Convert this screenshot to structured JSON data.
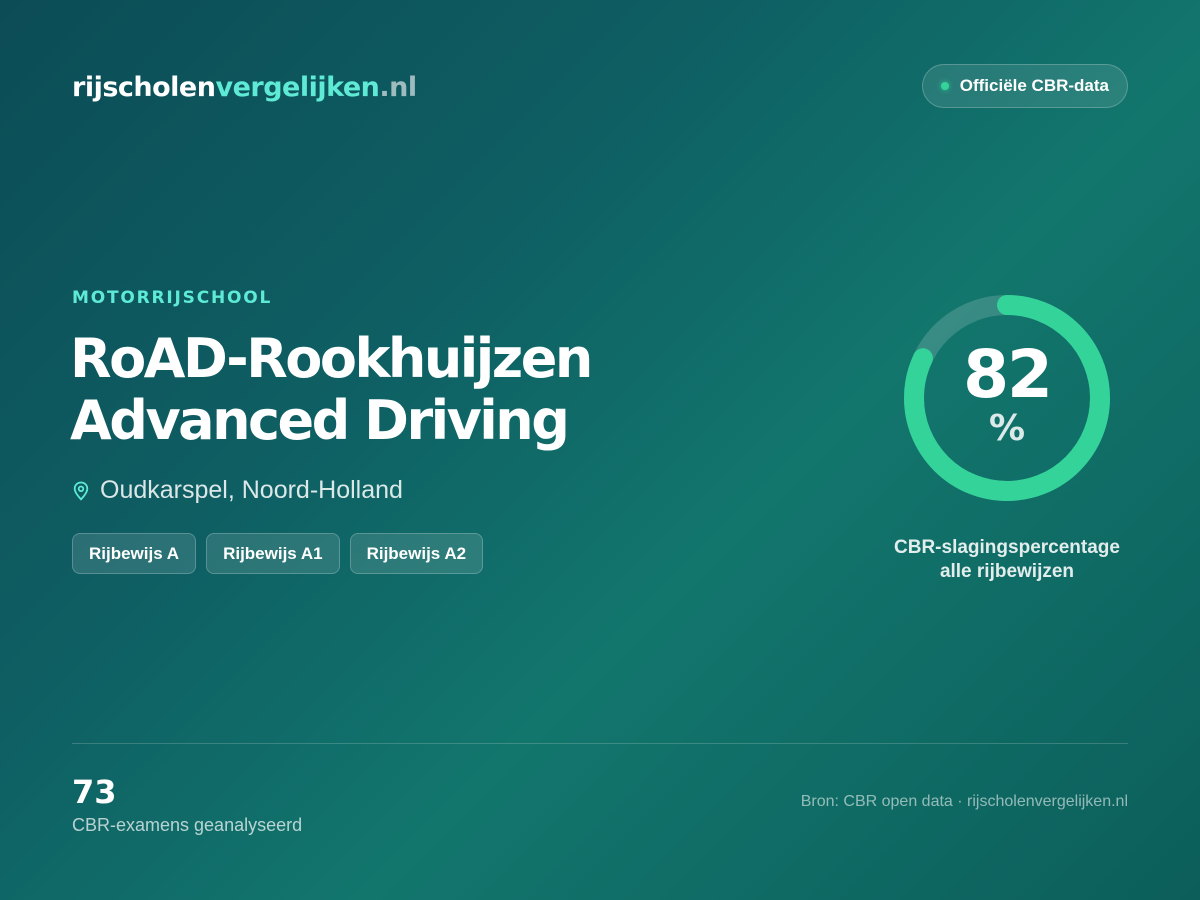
{
  "header": {
    "logo": {
      "part1": "rijscholen",
      "part2": "vergelijken",
      "part3": ".nl"
    },
    "badge": {
      "icon": "status-dot-icon",
      "label": "Officiële CBR-data"
    }
  },
  "school": {
    "category": "MOTORRIJSCHOOL",
    "name": "RoAD-Rookhuijzen Advanced Driving",
    "location_icon": "map-pin-icon",
    "location": "Oudkarspel, Noord-Holland",
    "licenses": [
      "Rijbewijs A",
      "Rijbewijs A1",
      "Rijbewijs A2"
    ]
  },
  "pass_rate": {
    "value": "82",
    "percent_value": 82,
    "unit": "%",
    "caption_line1": "CBR-slagingspercentage",
    "caption_line2": "alle rijbewijzen"
  },
  "footer": {
    "exam_count": "73",
    "exam_label": "CBR-examens geanalyseerd",
    "source": "Bron: CBR open data · rijscholenvergelijken.nl"
  },
  "colors": {
    "accent": "#5eead4",
    "gauge": "#34d399",
    "background_start": "#0c4c56",
    "background_end": "#12766d"
  }
}
